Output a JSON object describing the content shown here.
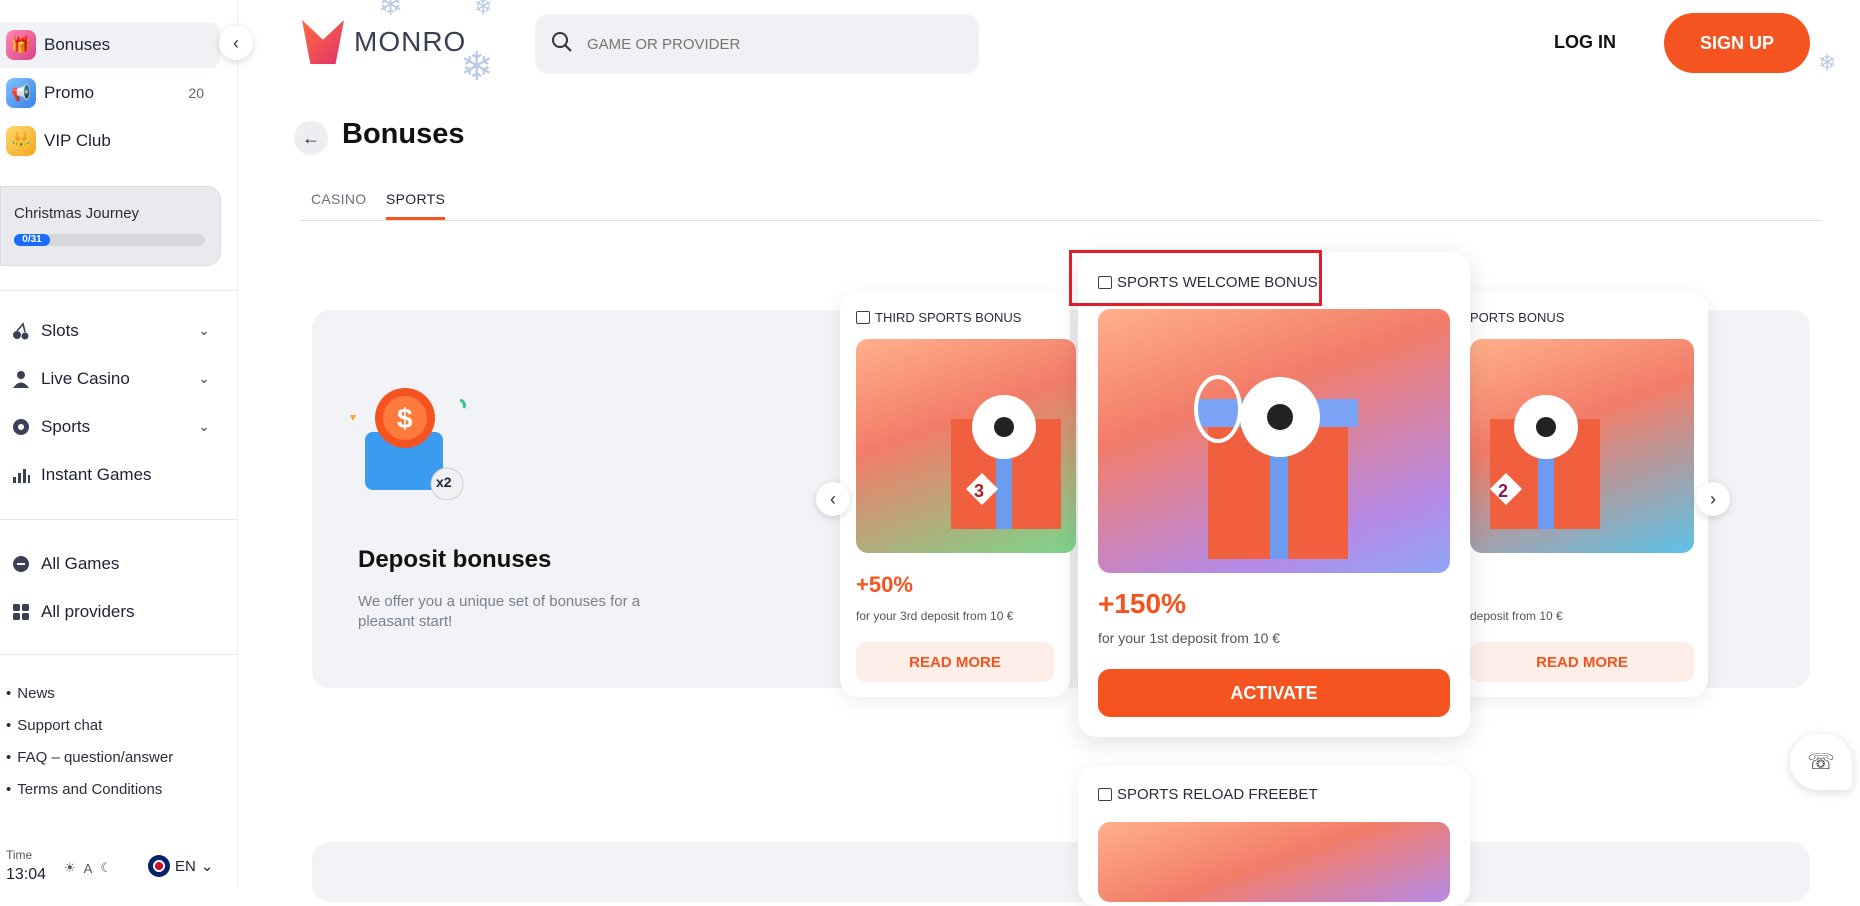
{
  "sidebar": {
    "top_items": [
      {
        "label": "Bonuses",
        "icon": "gift-icon"
      },
      {
        "label": "Promo",
        "icon": "promo-icon",
        "count": "20"
      },
      {
        "label": "VIP Club",
        "icon": "crown-icon"
      }
    ],
    "journey": {
      "title": "Christmas Journey",
      "progress": "0/31",
      "progress_value": 0
    },
    "nav": [
      {
        "label": "Slots",
        "icon": "cherry-icon"
      },
      {
        "label": "Live Casino",
        "icon": "dealer-icon"
      },
      {
        "label": "Sports",
        "icon": "ball-icon"
      },
      {
        "label": "Instant Games",
        "icon": "chart-icon"
      }
    ],
    "nav2": [
      {
        "label": "All Games",
        "icon": "games-icon"
      },
      {
        "label": "All providers",
        "icon": "grid-icon"
      }
    ],
    "links": [
      "News",
      "Support chat",
      "FAQ – question/answer",
      "Terms and Conditions"
    ],
    "time_label": "Time",
    "time_value": "13:04",
    "lang": "EN"
  },
  "header": {
    "logo": "MONRO",
    "search_placeholder": "GAME OR PROVIDER",
    "login": "LOG IN",
    "signup": "SIGN UP"
  },
  "page": {
    "title": "Bonuses",
    "tabs": [
      "CASINO",
      "SPORTS"
    ],
    "active_tab": "SPORTS"
  },
  "promo": {
    "badge": "x2",
    "title": "Deposit bonuses",
    "text": "We offer you a unique set of bonuses for a pleasant start!"
  },
  "cards": {
    "left": {
      "title": "THIRD SPORTS BONUS",
      "number": "3",
      "percent": "+50%",
      "sub": "for your 3rd deposit from 10 €",
      "button": "READ MORE"
    },
    "center": {
      "title": "SPORTS WELCOME BONUS",
      "percent": "+150%",
      "sub": "for your 1st deposit from 10 €",
      "button": "ACTIVATE"
    },
    "right": {
      "title": "PORTS BONUS",
      "number": "2",
      "sub": "deposit from 10 €",
      "button": "READ MORE"
    },
    "below": {
      "title": "SPORTS RELOAD FREEBET"
    }
  },
  "colors": {
    "accent": "#f5531f",
    "highlight": "#e11d2a"
  }
}
